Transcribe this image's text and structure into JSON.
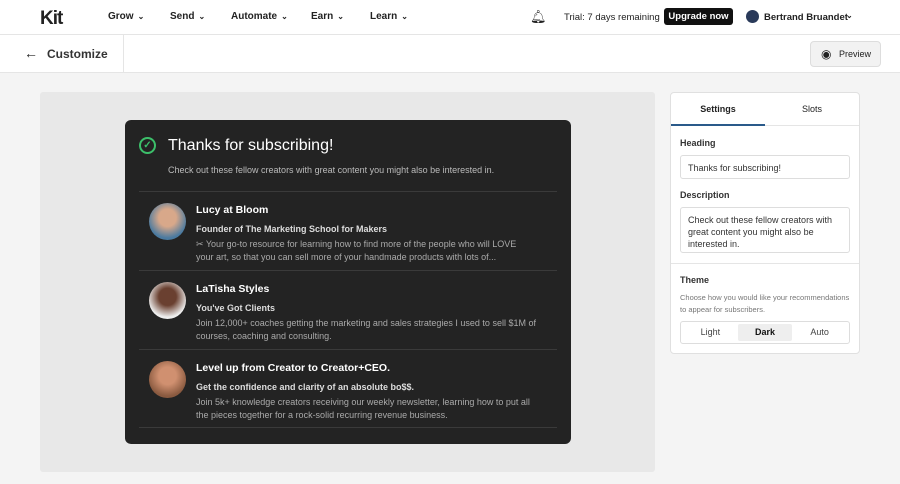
{
  "header": {
    "logo": "Kit",
    "nav": [
      "Grow",
      "Send",
      "Automate",
      "Earn",
      "Learn"
    ],
    "trial": "Trial: 7 days remaining",
    "upgrade": "Upgrade now",
    "user": "Bertrand Bruandet"
  },
  "subheader": {
    "title": "Customize",
    "preview": "Preview"
  },
  "card": {
    "heading": "Thanks for subscribing!",
    "description": "Check out these fellow creators with great content you might also be interested in.",
    "items": [
      {
        "name": "Lucy at Bloom",
        "tagline": "Founder of The Marketing School for Makers",
        "desc": "✂ Your go-to resource for learning how to find more of the people who will LOVE your art, so that you can sell more of your handmade products with lots of..."
      },
      {
        "name": "LaTisha Styles",
        "tagline": "You've Got Clients",
        "desc": "Join 12,000+ coaches getting the marketing and sales strategies I used to sell $1M of courses, coaching and consulting."
      },
      {
        "name": "Level up from Creator to Creator+CEO.",
        "tagline": "Get the confidence and clarity of an absolute bo$$.",
        "desc": "Join 5k+ knowledge creators receiving our weekly newsletter, learning how to put all the pieces together for a rock-solid recurring revenue business."
      }
    ]
  },
  "panel": {
    "tabs": [
      "Settings",
      "Slots"
    ],
    "heading_label": "Heading",
    "heading_value": "Thanks for subscribing!",
    "description_label": "Description",
    "description_value": "Check out these fellow creators with great content you might also be interested in.",
    "theme_label": "Theme",
    "theme_hint": "Choose how you would like your recommendations to appear for subscribers.",
    "themes": [
      "Light",
      "Dark",
      "Auto"
    ],
    "selected_theme": "Dark"
  }
}
